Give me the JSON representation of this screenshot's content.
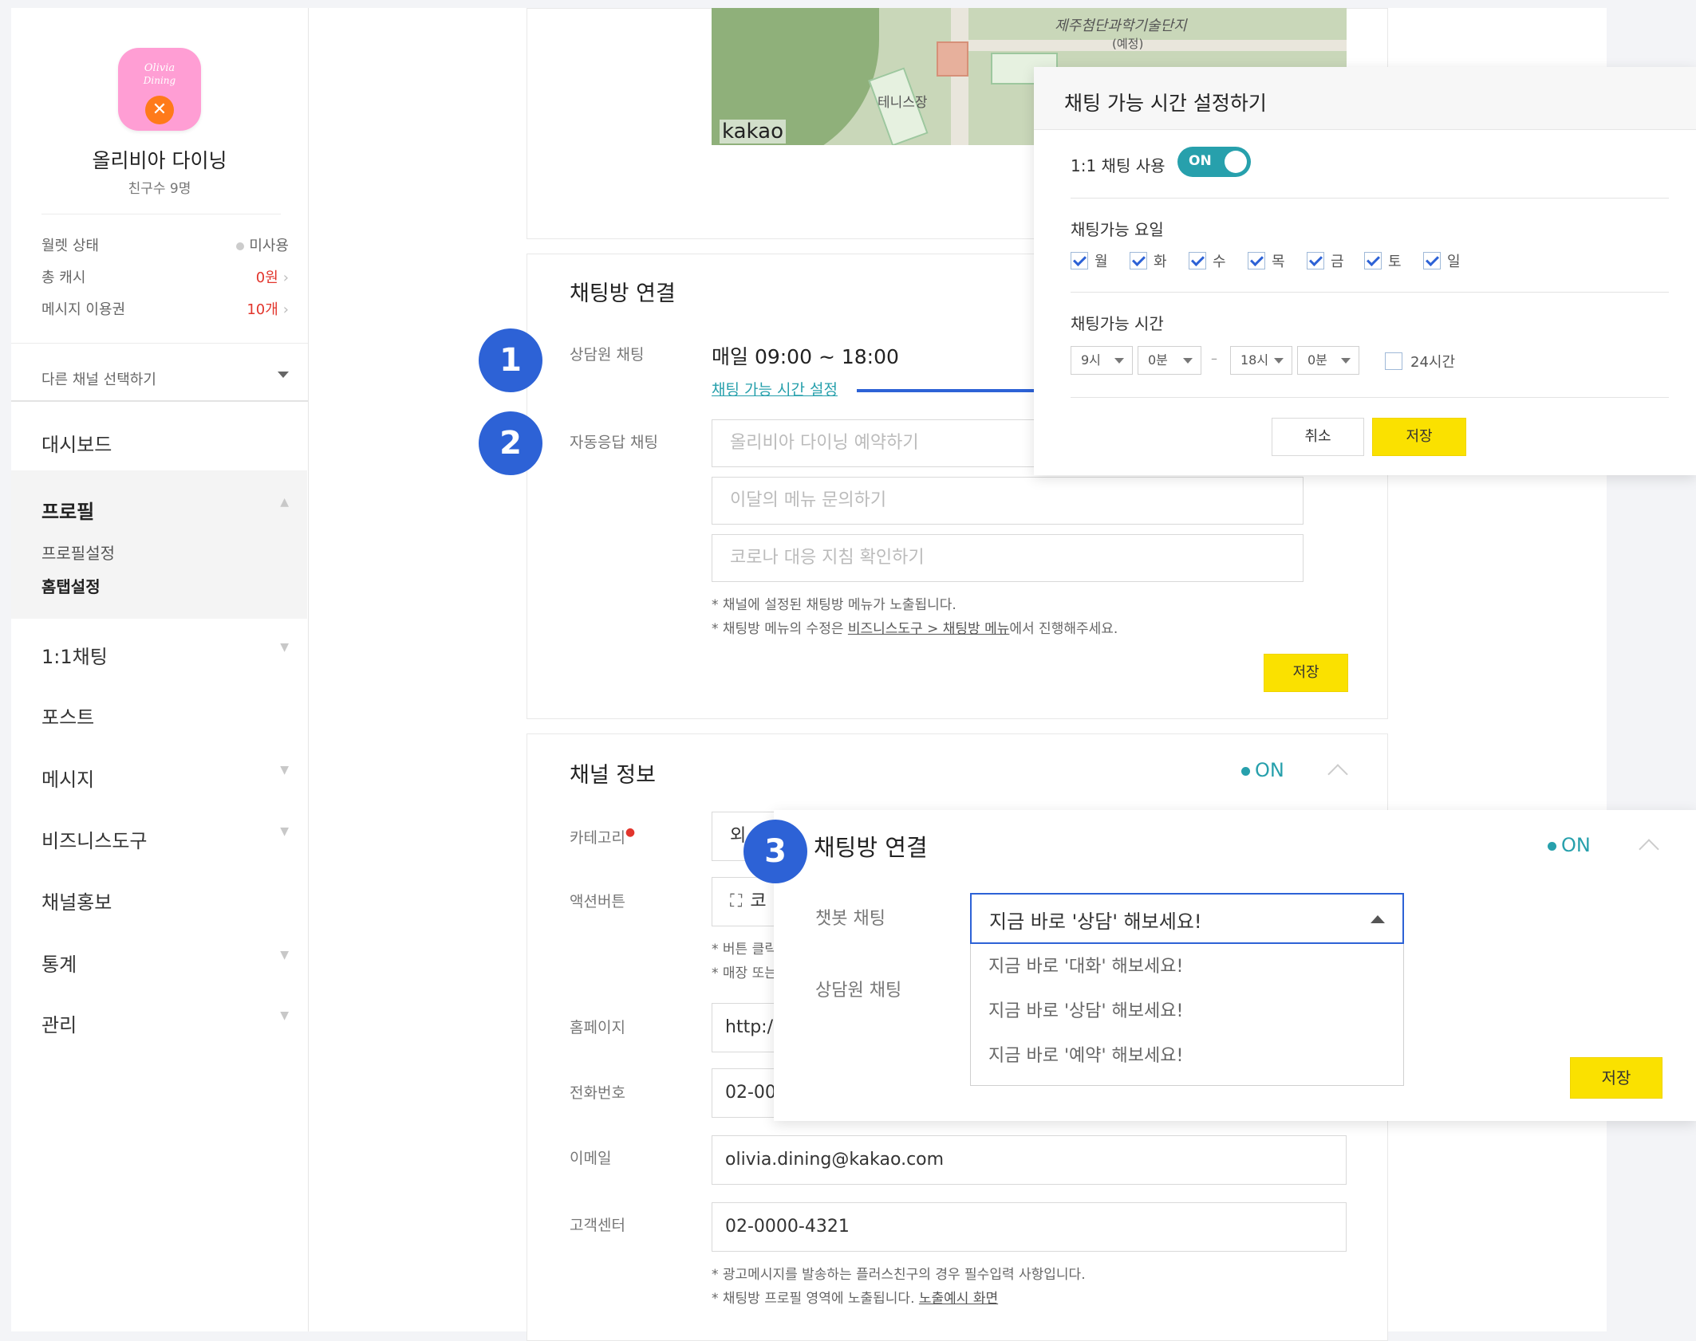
{
  "sidebar": {
    "logo_line1": "Olivia",
    "logo_line2": "Dining",
    "channel_name": "올리비아 다이닝",
    "friends": "친구수 9명",
    "wallet_label": "월렛 상태",
    "wallet_value": "미사용",
    "cash_label": "총 캐시",
    "cash_value": "0원",
    "msg_label": "메시지 이용권",
    "msg_value": "10개",
    "channel_select": "다른 채널 선택하기",
    "nav": {
      "dashboard": "대시보드",
      "profile": "프로필",
      "profile_settings": "프로필설정",
      "hometab_settings": "홈탭설정",
      "chat": "1:1채팅",
      "post": "포스트",
      "message": "메시지",
      "biz_tools": "비즈니스도구",
      "promo": "채널홍보",
      "stats": "통계",
      "manage": "관리"
    }
  },
  "map": {
    "label_complex": "제주첨단과학기술단지",
    "label_planned": "(예정)",
    "label_tennis": "테니스장",
    "brand": "kakao"
  },
  "chatroom": {
    "title": "채팅방 연결",
    "agent_label": "상담원 채팅",
    "agent_hours": "매일 09:00 ~ 18:00",
    "hours_link": "채팅 가능 시간 설정",
    "auto_label": "자동응답 채팅",
    "auto_items": [
      "올리비아 다이닝 예약하기",
      "이달의 메뉴 문의하기",
      "코로나 대응 지침 확인하기"
    ],
    "note1": "* 채널에 설정된 채팅방 메뉴가 노출됩니다.",
    "note2_pre": "* 채팅방 메뉴의 수정은 ",
    "note2_link": "비즈니스도구 > 채팅방 메뉴",
    "note2_post": "에서 진행해주세요.",
    "save": "저장"
  },
  "channel_info": {
    "title": "채널 정보",
    "status": "ON",
    "category_label": "카테고리",
    "category_value": "외",
    "action_label": "액션버튼",
    "action_value": "코",
    "note_a": "* 버튼 클릭",
    "note_b": "* 매장 또는",
    "homepage_label": "홈페이지",
    "homepage_value": "http:/",
    "phone_label": "전화번호",
    "phone_value": "02-00",
    "email_label": "이메일",
    "email_value": "olivia.dining@kakao.com",
    "cs_label": "고객센터",
    "cs_value": "02-0000-4321",
    "note3": "* 광고메시지를 발송하는 플러스친구의 경우 필수입력 사항입니다.",
    "note4_pre": "* 채팅방 프로필 영역에 노출됩니다. ",
    "note4_link": "노출예시 화면"
  },
  "popup_hours": {
    "title": "채팅 가능 시간 설정하기",
    "use_label": "1:1 채팅 사용",
    "toggle": "ON",
    "days_label": "채팅가능 요일",
    "days": [
      "월",
      "화",
      "수",
      "목",
      "금",
      "토",
      "일"
    ],
    "time_label": "채팅가능 시간",
    "start_hour": "9시",
    "start_min": "0분",
    "dash": "–",
    "end_hour": "18시",
    "end_min": "0분",
    "allday": "24시간",
    "cancel": "취소",
    "save": "저장"
  },
  "popup_bot": {
    "title": "채팅방 연결",
    "status": "ON",
    "bot_label": "챗봇 채팅",
    "agent_label": "상담원 채팅",
    "selected": "지금 바로 '상담' 해보세요!",
    "options": [
      "지금 바로 '대화' 해보세요!",
      "지금 바로 '상담' 해보세요!",
      "지금 바로 '예약' 해보세요!"
    ],
    "save": "저장"
  },
  "badges": [
    "1",
    "2",
    "3"
  ],
  "colors": {
    "accent_blue": "#2d62d6",
    "teal": "#27a0ac",
    "yellow": "#fae100",
    "red": "#e2352c"
  }
}
